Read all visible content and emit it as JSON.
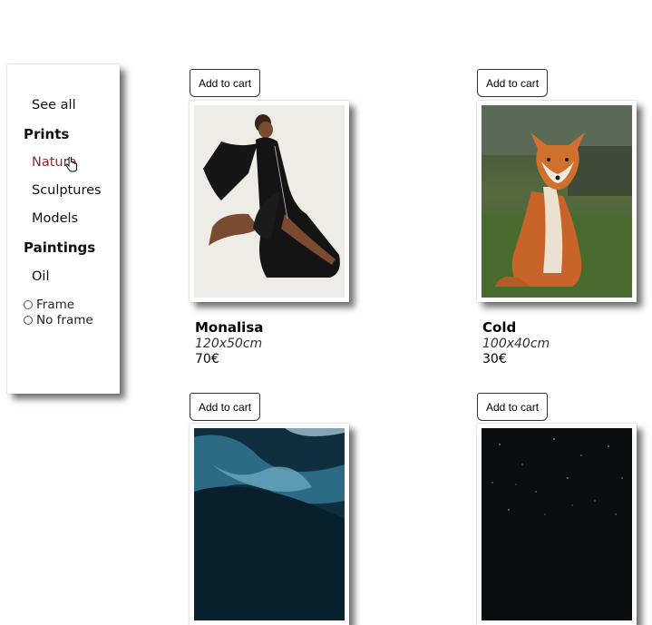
{
  "sidebar": {
    "see_all": "See all",
    "prints_heading": "Prints",
    "prints_items": [
      "Nature",
      "Sculptures",
      "Models"
    ],
    "paintings_heading": "Paintings",
    "paintings_items": [
      "Oil"
    ],
    "frame_options": [
      "Frame",
      "No frame"
    ],
    "active_item": "Nature",
    "active_color": "#8b2b2b"
  },
  "products": [
    {
      "button": "Add to cart",
      "title": "Monalisa",
      "size": "120x50cm",
      "price": "70€",
      "image": "woman-black-dress-photo"
    },
    {
      "button": "Add to cart",
      "title": "Cold",
      "size": "100x40cm",
      "price": "30€",
      "image": "red-fox-photo"
    },
    {
      "button": "Add to cart",
      "title": "",
      "size": "",
      "price": "",
      "image": "blue-ink-abstract-photo"
    },
    {
      "button": "Add to cart",
      "title": "",
      "size": "",
      "price": "",
      "image": "night-sky-stars-photo"
    }
  ]
}
